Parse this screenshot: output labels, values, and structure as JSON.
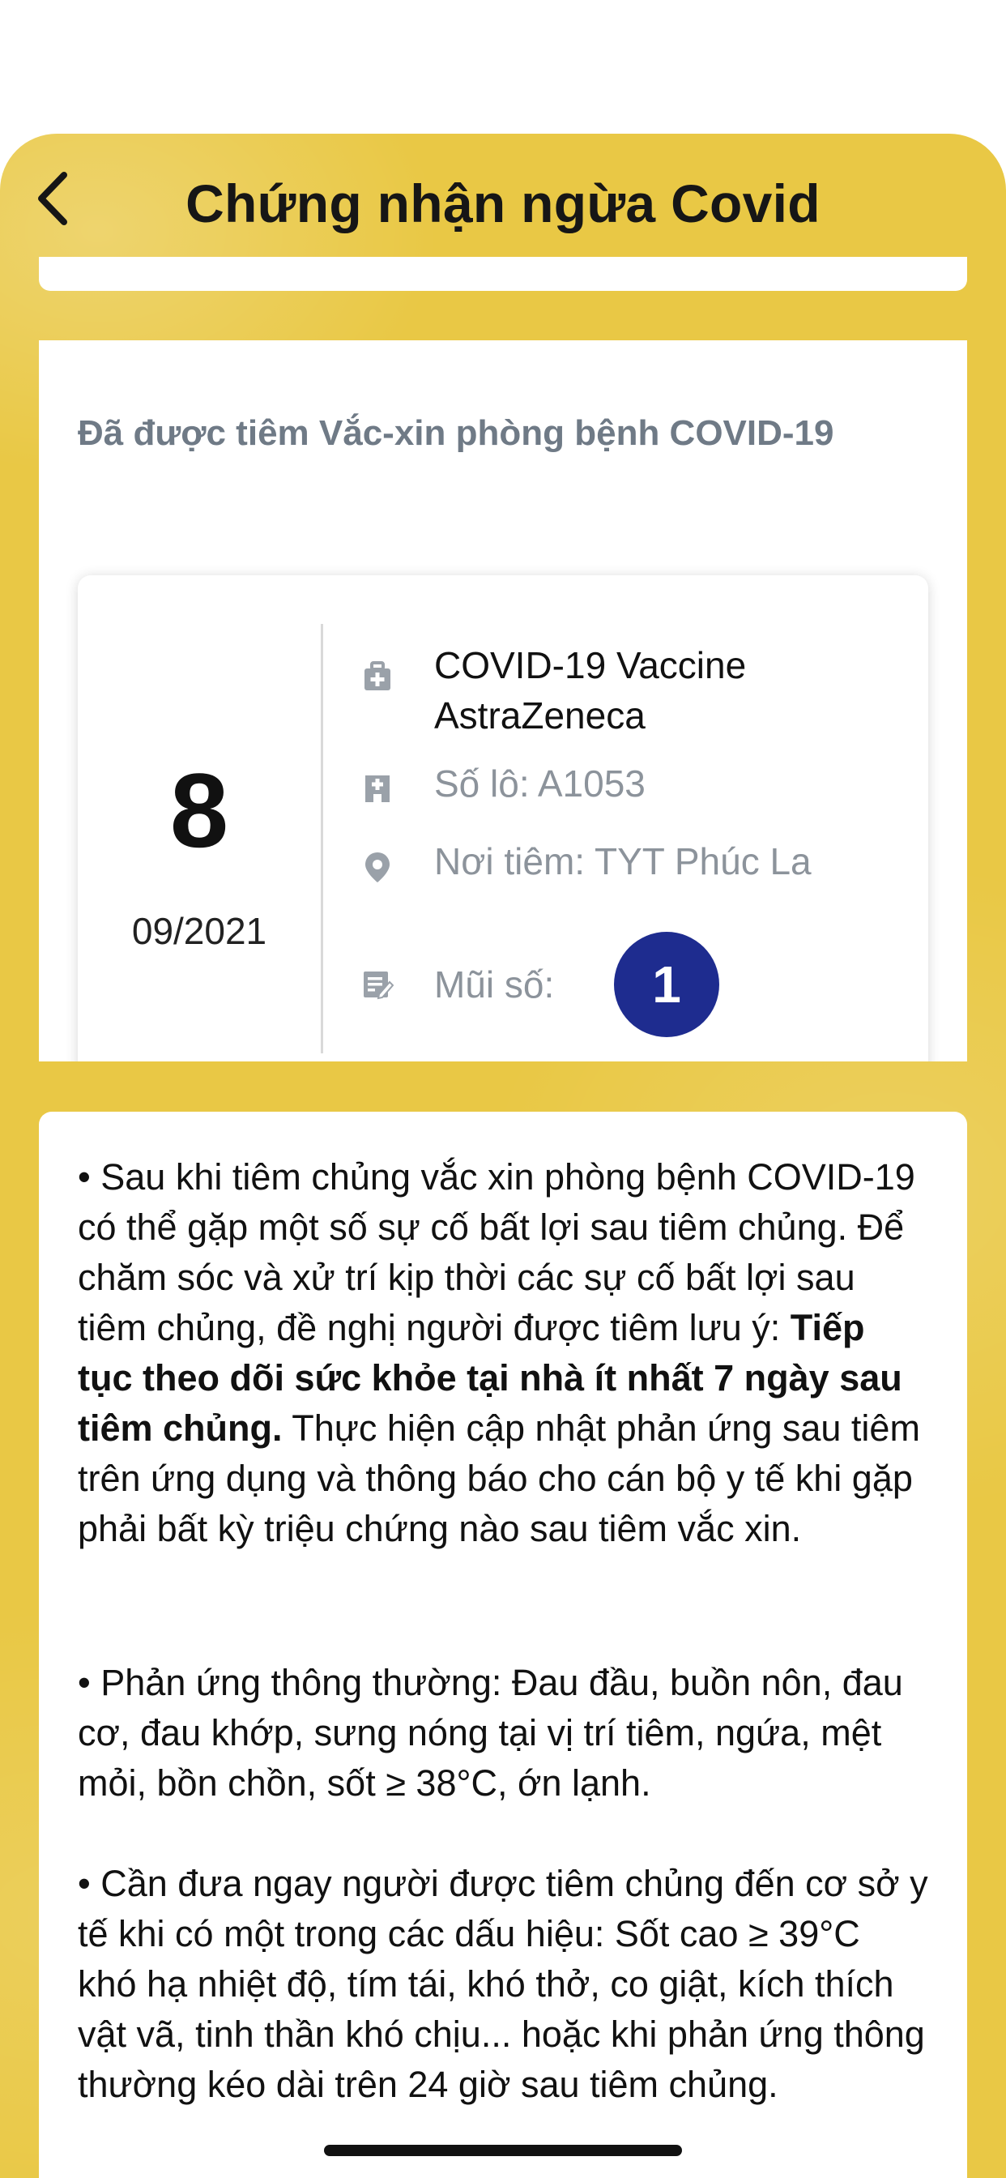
{
  "header": {
    "title": "Chứng nhận ngừa Covid"
  },
  "summary": {
    "heading": "Đã được tiêm Vắc-xin phòng bệnh COVID-19"
  },
  "dose_record": {
    "day": "8",
    "month_year": "09/2021",
    "vaccine_name": "COVID-19 Vaccine AstraZeneca",
    "lot": "Số lô: A1053",
    "place": "Nơi tiêm: TYT Phúc La",
    "dose_label": "Mũi số:",
    "dose_number": "1",
    "icons": {
      "vaccine": "medical-bag-icon",
      "lot": "hospital-building-icon",
      "place": "location-pin-icon",
      "dose": "edit-note-icon"
    }
  },
  "notes": {
    "p1_prefix": "• Sau khi tiêm chủng vắc xin phòng bệnh COVID-19 có thể gặp một số sự cố bất lợi sau tiêm chủng. Để chăm sóc và xử trí kịp thời các sự cố bất lợi sau tiêm chủng, đề nghị người được tiêm lưu ý: ",
    "p1_bold": "Tiếp tục theo dõi sức khỏe tại nhà ít nhất 7 ngày sau tiêm chủng.",
    "p1_suffix": " Thực hiện cập nhật phản ứng sau tiêm trên ứng dụng và thông báo cho cán bộ y tế khi gặp phải bất kỳ triệu chứng nào sau tiêm vắc xin.",
    "p2": "• Phản ứng thông thường: Đau đầu, buồn nôn, đau cơ, đau khớp, sưng nóng tại vị trí tiêm, ngứa, mệt mỏi, bồn chồn, sốt ≥ 38°C, ớn lạnh.",
    "p3": "• Cần đưa ngay người được tiêm chủng đến cơ sở y tế khi có một trong các dấu hiệu: Sốt cao ≥ 39°C khó hạ nhiệt độ, tím tái, khó thở, co giật, kích thích vật vã, tinh thần khó chịu... hoặc khi phản ứng thông thường kéo dài trên 24 giờ sau tiêm chủng."
  },
  "colors": {
    "background": "#e9c845",
    "badge": "#1e2c8f",
    "muted_text": "#8c939b"
  }
}
